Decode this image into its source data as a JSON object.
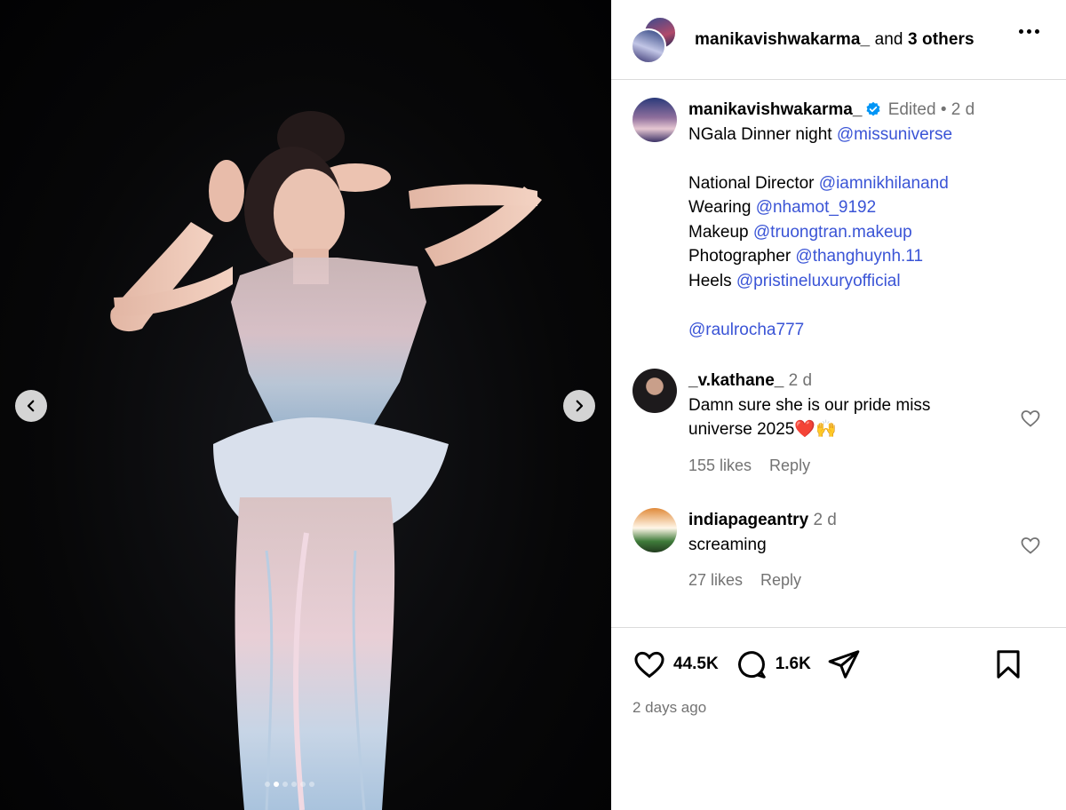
{
  "header": {
    "username": "manikavishwakarma_",
    "and_text": "and",
    "others_text": "3 others"
  },
  "caption": {
    "username": "manikavishwakarma_",
    "edited": "Edited •",
    "age": "2 d",
    "lines": {
      "l1_text": "NGala Dinner night ",
      "l1_link": "@missuniverse",
      "l2_text": "National Director ",
      "l2_link": "@iamnikhilanand",
      "l3_text": "Wearing ",
      "l3_link": "@nhamot_9192",
      "l4_text": "Makeup ",
      "l4_link": "@truongtran.makeup",
      "l5_text": "Photographer ",
      "l5_link": "@thanghuynh.11",
      "l6_text": "Heels ",
      "l6_link": "@pristineluxuryofficial",
      "l7_link": "@raulrocha777"
    }
  },
  "comments": [
    {
      "username": "_v.kathane_",
      "age": "2 d",
      "text_line1": "Damn sure she is our pride miss",
      "text_line2": "universe 2025❤️🙌",
      "likes": "155 likes",
      "reply": "Reply"
    },
    {
      "username": "indiapageantry",
      "age": "2 d",
      "text_line1": "screaming",
      "likes": "27 likes",
      "reply": "Reply"
    }
  ],
  "footer": {
    "likes_count": "44.5K",
    "comments_count": "1.6K",
    "timestamp": "2 days ago"
  },
  "colors": {
    "link": "#3a54d6",
    "verified": "#0095f6",
    "muted": "#737373"
  },
  "icons": [
    "chevron-left-icon",
    "chevron-right-icon",
    "more-icon",
    "verified-icon",
    "heart-icon",
    "comment-icon",
    "share-icon",
    "bookmark-icon"
  ],
  "carousel": {
    "slide_count": 6,
    "active_index": 1
  }
}
